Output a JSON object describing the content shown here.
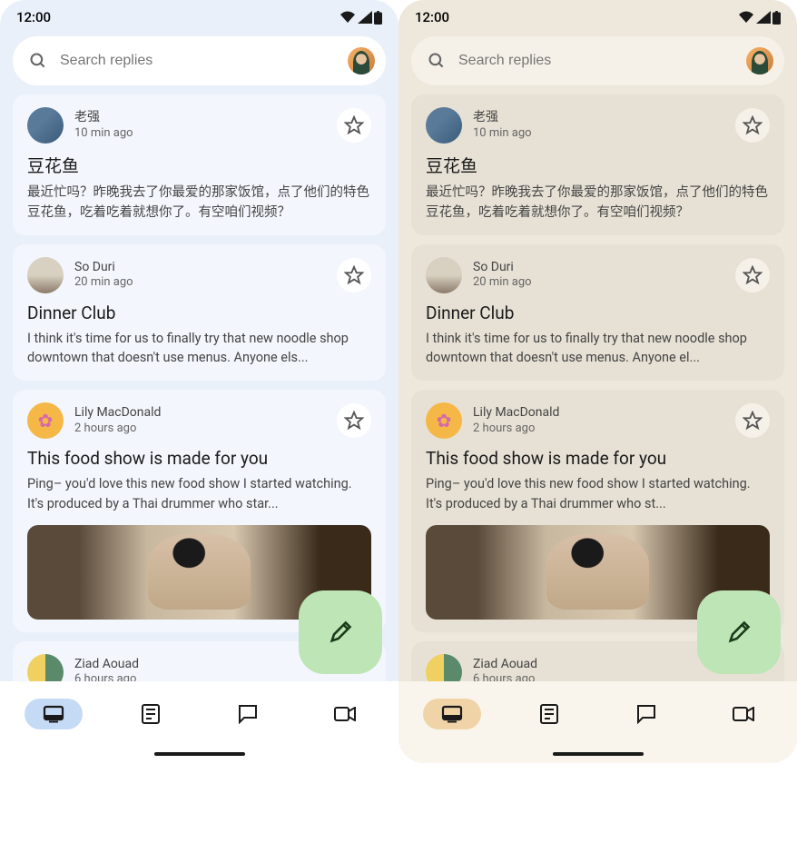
{
  "statusbar": {
    "time": "12:00"
  },
  "search": {
    "placeholder": "Search replies"
  },
  "cards": [
    {
      "name": "老强",
      "time": "10 min ago",
      "title": "豆花鱼",
      "body_left": "最近忙吗？昨晚我去了你最爱的那家饭馆，点了他们的特色豆花鱼，吃着吃着就想你了。有空咱们视频？",
      "body_right": "最近忙吗？昨晚我去了你最爱的那家饭馆，点了他们的特色豆花鱼，吃着吃着就想你了。有空咱们视频？"
    },
    {
      "name": "So Duri",
      "time": "20 min ago",
      "title": "Dinner Club",
      "body_left": "I think it's time for us to finally try that new noodle shop downtown that doesn't use menus. Anyone els...",
      "body_right": "I think it's time for us to finally try that new noodle shop downtown that doesn't use menus. Anyone el..."
    },
    {
      "name": "Lily MacDonald",
      "time": "2 hours ago",
      "title": "This food show is made for you",
      "body_left": "Ping– you'd love this new food show I started watching. It's produced by a Thai drummer who star...",
      "body_right": "Ping– you'd love this new food show I started watching. It's produced by a Thai drummer who st..."
    },
    {
      "name": "Ziad Aouad",
      "time": "6 hours ago",
      "title": "",
      "body_left": "",
      "body_right": ""
    }
  ],
  "icons": {
    "search": "search-icon",
    "star": "star-icon",
    "compose": "pencil-icon",
    "nav": [
      "home-filled-icon",
      "article-icon",
      "chat-icon",
      "video-icon"
    ]
  }
}
